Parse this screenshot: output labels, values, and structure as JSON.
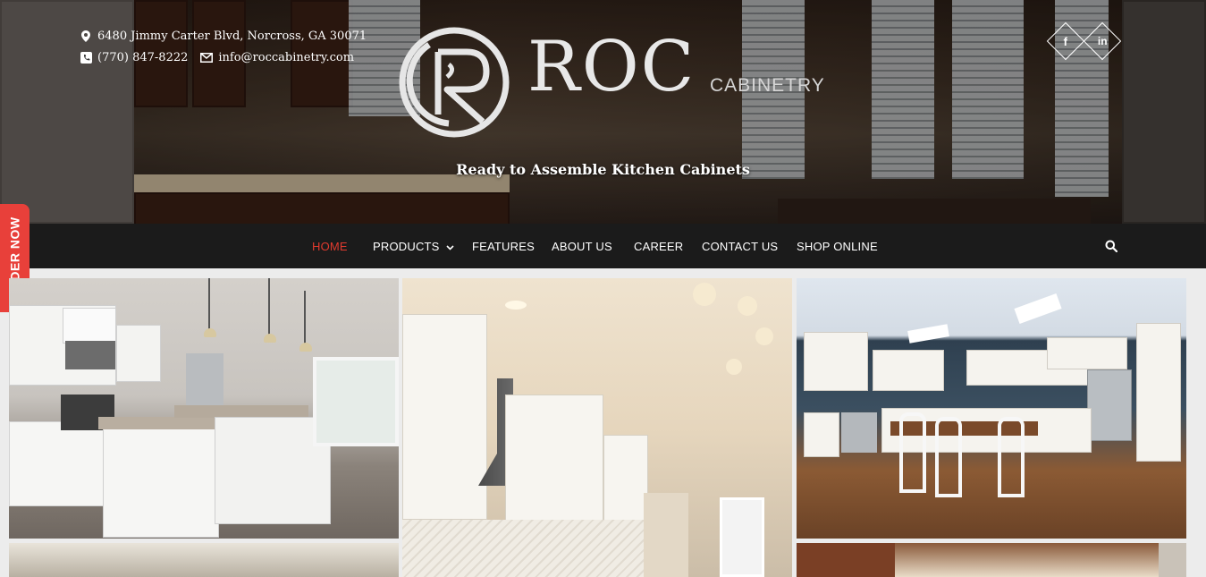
{
  "contact": {
    "address": "6480 Jimmy Carter Blvd, Norcross, GA 30071",
    "phone": "(770) 847-8222",
    "email": "info@roccabinetry.com",
    "icons": [
      "map-marker-icon",
      "phone-icon",
      "envelope-icon"
    ]
  },
  "brand": {
    "logo_text": "ROC",
    "logo_sub": "CABINETRY",
    "tagline": "Ready to Assemble Kitchen Cabinets"
  },
  "social": {
    "facebook_glyph": "f",
    "linkedin_glyph": "in"
  },
  "nav": {
    "items": [
      {
        "label": "HOME",
        "active": true
      },
      {
        "label": "PRODUCTS",
        "has_dropdown": true
      },
      {
        "label": "FEATURES"
      },
      {
        "label": "ABOUT US"
      },
      {
        "label": "CAREER"
      },
      {
        "label": "CONTACT US"
      },
      {
        "label": "SHOP ONLINE"
      }
    ],
    "search_icon": "search-icon"
  },
  "order_tab": {
    "label": "ORDER NOW"
  },
  "colors": {
    "accent": "#e03a2e",
    "nav_bg": "#1b1b1b",
    "order_tab": "#e8403a"
  }
}
